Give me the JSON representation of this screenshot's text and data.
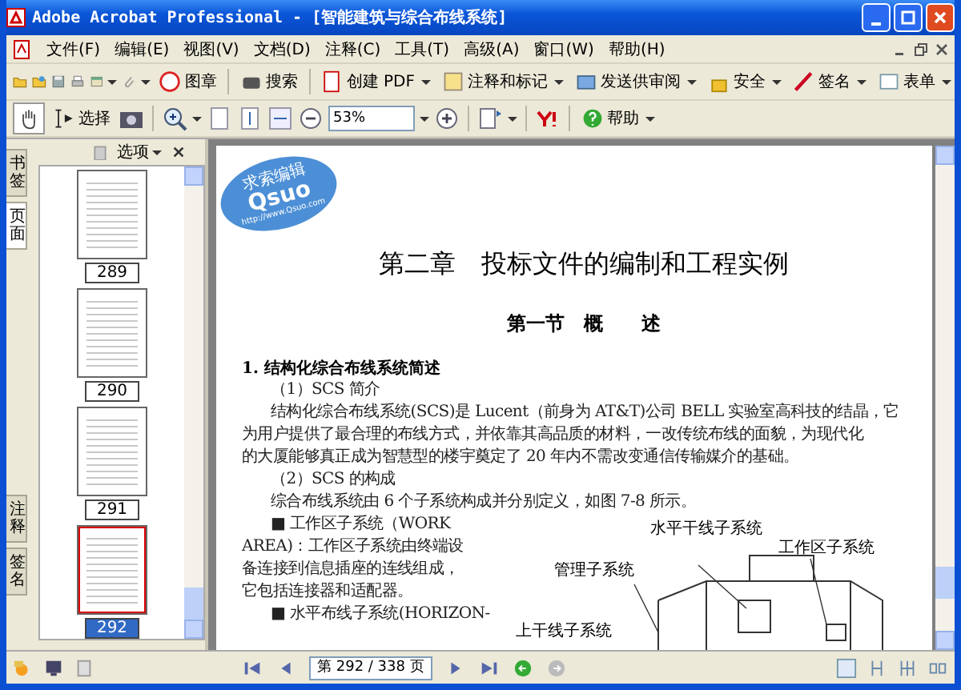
{
  "window": {
    "title": "Adobe Acrobat Professional - [智能建筑与综合布线系统]"
  },
  "menu": [
    "文件(F)",
    "编辑(E)",
    "视图(V)",
    "文档(D)",
    "注释(C)",
    "工具(T)",
    "高级(A)",
    "窗口(W)",
    "帮助(H)"
  ],
  "toolbar_1": [
    "图章",
    "搜索",
    "创建 PDF",
    "注释和标记",
    "发送供审阅",
    "安全",
    "签名",
    "表单"
  ],
  "toolbar_2": {
    "select_tool": "选择",
    "zoom": "53%",
    "help": "帮助"
  },
  "side_panel": {
    "options": "选项",
    "tabs": [
      {
        "label": "书签",
        "selected": false
      },
      {
        "label": "页面",
        "selected": true
      },
      {
        "label": "注释",
        "selected": false
      },
      {
        "label": "签名",
        "selected": false
      }
    ],
    "thumbnails": [
      {
        "page": "289",
        "selected": false
      },
      {
        "page": "290",
        "selected": false
      },
      {
        "page": "291",
        "selected": false
      },
      {
        "page": "292",
        "selected": true
      }
    ]
  },
  "document": {
    "logo": {
      "brand": "Qsuo",
      "tagline": "求索编辑",
      "url": "http://www.Qsuo.com"
    },
    "chapter_title": "第二章　投标文件的编制和工程实例",
    "section_title": "第一节　概　　述",
    "heading": "1. 结构化综合布线系统简述",
    "lines": [
      {
        "text": "（1）SCS 简介",
        "kind": "indent"
      },
      {
        "text": "结构化综合布线系统(SCS)是 Lucent（前身为 AT&T)公司 BELL 实验室高科技的结晶，它",
        "kind": "indent"
      },
      {
        "text": "为用户提供了最合理的布线方式，并依靠其高品质的材料，一改传统布线的面貌，为现代化",
        "kind": "flush"
      },
      {
        "text": "的大厦能够真正成为智慧型的楼宇奠定了 20 年内不需改变通信传输媒介的基础。",
        "kind": "flush"
      },
      {
        "text": "（2）SCS 的构成",
        "kind": "indent"
      },
      {
        "text": "综合布线系统由 6 个子系统构成并分别定义，如图 7-8 所示。",
        "kind": "indent"
      }
    ],
    "column_lines": [
      {
        "text": "■ 工作区子系统（WORK",
        "kind": "indent"
      },
      {
        "text": "AREA)：工作区子系统由终端设",
        "kind": "flush"
      },
      {
        "text": "备连接到信息插座的连线组成，",
        "kind": "flush"
      },
      {
        "text": "它包括连接器和适配器。",
        "kind": "flush"
      },
      {
        "text": "■ 水平布线子系统(HORIZON-",
        "kind": "indent"
      }
    ],
    "figure_labels": [
      "水平干线子系统",
      "工作区子系统",
      "管理子系统",
      "上干线子系统"
    ]
  },
  "navigation": {
    "page_field": "第 292 / 338 页"
  }
}
